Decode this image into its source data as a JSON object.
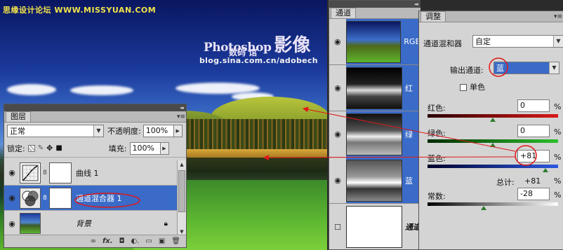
{
  "watermark": {
    "site": "思缘设计论坛 WWW.MISSYUAN.COM",
    "brand_line1": "Photoshop",
    "brand_line2": "影像",
    "brand_line3": "数码 馆",
    "url": "blog.sina.com.cn/adobech"
  },
  "layers_panel": {
    "tab_label": "图层",
    "blend_mode": "正常",
    "opacity_label": "不透明度:",
    "opacity_value": "100%",
    "lock_label": "锁定:",
    "fill_label": "填充:",
    "fill_value": "100%",
    "layers": [
      {
        "name": "曲线 1",
        "kind": "curves"
      },
      {
        "name": "通道混合器 1",
        "kind": "channel-mixer"
      },
      {
        "name": "背景",
        "kind": "background"
      }
    ],
    "footer_icons": [
      "link-icon",
      "fx-icon",
      "mask-icon",
      "adjustment-icon",
      "folder-icon",
      "new-layer-icon",
      "trash-icon"
    ]
  },
  "channels_panel": {
    "tab_label": "通道",
    "channels": [
      {
        "name": "RGB",
        "selected": true
      },
      {
        "name": "红",
        "selected": true
      },
      {
        "name": "绿",
        "selected": true
      },
      {
        "name": "蓝",
        "selected": true
      },
      {
        "name": "通道",
        "selected": false
      }
    ]
  },
  "adjust_panel": {
    "tab_label": "调整",
    "type_label": "通道混和器",
    "preset_value": "自定",
    "output_label": "输出通道:",
    "output_value": "蓝",
    "mono_label": "单色",
    "red_label": "红色:",
    "red_value": "0",
    "green_label": "绿色:",
    "green_value": "0",
    "blue_label": "蓝色:",
    "blue_value": "+81",
    "total_label": "总计:",
    "total_value": "+81",
    "const_label": "常数:",
    "const_value": "-28",
    "percent": "%",
    "red_level": 0.5,
    "green_level": 0.5,
    "blue_level": 0.905,
    "const_level": 0.43
  },
  "colors": {
    "selection_blue": "#3a6bc8",
    "panel_gray": "#d4d4d4",
    "annotation_red": "#e01818"
  }
}
